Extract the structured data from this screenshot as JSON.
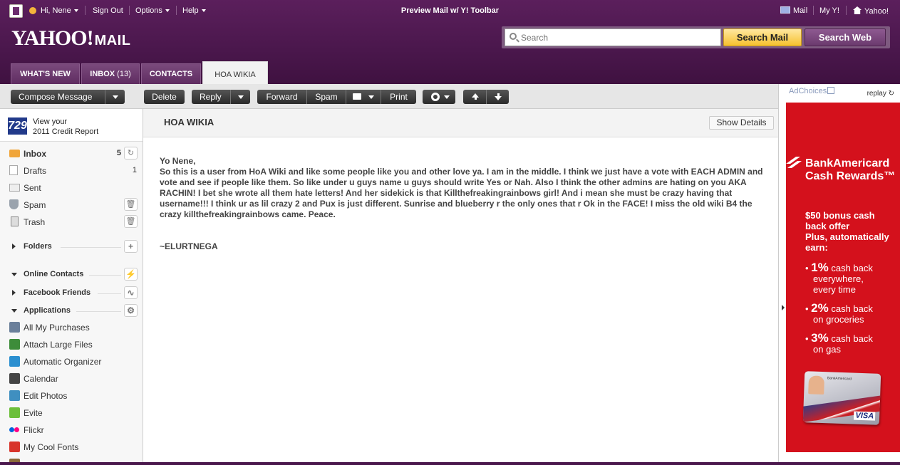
{
  "topbar": {
    "greeting": "Hi, Nene",
    "sign_out": "Sign Out",
    "options": "Options",
    "help": "Help",
    "title": "Preview Mail w/ Y! Toolbar",
    "mail": "Mail",
    "my_y": "My Y!",
    "yahoo": "Yahoo!"
  },
  "logo": {
    "brand": "YAHOO!",
    "product": "MAIL"
  },
  "search": {
    "placeholder": "Search",
    "search_mail": "Search Mail",
    "search_web": "Search Web"
  },
  "tabs": [
    {
      "label": "WHAT'S NEW",
      "count": ""
    },
    {
      "label": "INBOX",
      "count": "(13)"
    },
    {
      "label": "CONTACTS",
      "count": ""
    },
    {
      "label": "HOA WIKIA",
      "count": ""
    }
  ],
  "toolbar": {
    "compose": "Compose Message",
    "delete": "Delete",
    "reply": "Reply",
    "forward": "Forward",
    "spam": "Spam",
    "print": "Print"
  },
  "sidebar": {
    "credit_line1": "View your",
    "credit_line2": "2011 Credit Report",
    "credit_logo": "729",
    "folders": [
      {
        "label": "Inbox",
        "count": "5",
        "icon": "inbox-icon"
      },
      {
        "label": "Drafts",
        "count": "1",
        "icon": "drafts-icon"
      },
      {
        "label": "Sent",
        "count": "",
        "icon": "sent-icon"
      },
      {
        "label": "Spam",
        "count": "",
        "icon": "spam-icon"
      },
      {
        "label": "Trash",
        "count": "",
        "icon": "trash-icon"
      }
    ],
    "sections": {
      "folders": "Folders",
      "online_contacts": "Online Contacts",
      "facebook_friends": "Facebook Friends",
      "applications": "Applications"
    },
    "apps": [
      {
        "label": "All My Purchases",
        "color": "#6a7f9a"
      },
      {
        "label": "Attach Large Files",
        "color": "#3d8c3a"
      },
      {
        "label": "Automatic Organizer",
        "color": "#2b8fd0"
      },
      {
        "label": "Calendar",
        "color": "#444444"
      },
      {
        "label": "Edit Photos",
        "color": "#3f8fc0"
      },
      {
        "label": "Evite",
        "color": "#6cbf3a"
      },
      {
        "label": "Flickr",
        "color": "#ff0084"
      },
      {
        "label": "My Cool Fonts",
        "color": "#d8342a"
      }
    ]
  },
  "message": {
    "title": "HOA WIKIA",
    "show_details": "Show Details",
    "greeting": "Yo Nene,",
    "body": "So this is a user from HoA Wiki and like some people like you and other love ya. I am in the middle. I think we just have a vote with EACH ADMIN and vote and see if people like them. So like under u guys name u guys should write Yes or Nah. Also I think the other admins are hating on you AKA RACHIN! I bet she wrote all them hate letters! And her sidekick is that Killthefreakingrainbows girl! And i mean she must be crazy having that username!!! I think ur as lil crazy 2 and Pux is just different. Sunrise and blueberry r the only ones that r Ok in the FACE! I miss the old wiki B4 the crazy killthefreakingrainbows came. Peace.",
    "signature": "~ELURTNEGA"
  },
  "ad": {
    "adchoices": "AdChoices",
    "replay": "replay",
    "bank_line1": "BankAmericard",
    "bank_line2": "Cash Rewards™",
    "offer_line1": "$50 bonus cash",
    "offer_line2": "back offer",
    "offer_line3": "Plus, automatically",
    "offer_line4": "earn:",
    "bullets": [
      {
        "pct": "1%",
        "line1": " cash back",
        "line2": "everywhere,",
        "line3": "every time"
      },
      {
        "pct": "2%",
        "line1": " cash back",
        "line2": "on groceries",
        "line3": ""
      },
      {
        "pct": "3%",
        "line1": " cash back",
        "line2": "on gas",
        "line3": ""
      }
    ],
    "card_brand": "BankAmericard",
    "card_visa": "VISA"
  },
  "colors": {
    "header_purple": "#4a174c",
    "search_mail_yellow": "#f6c12f",
    "ad_red": "#d4111c",
    "toolbar_button": "#2b2b2b"
  }
}
